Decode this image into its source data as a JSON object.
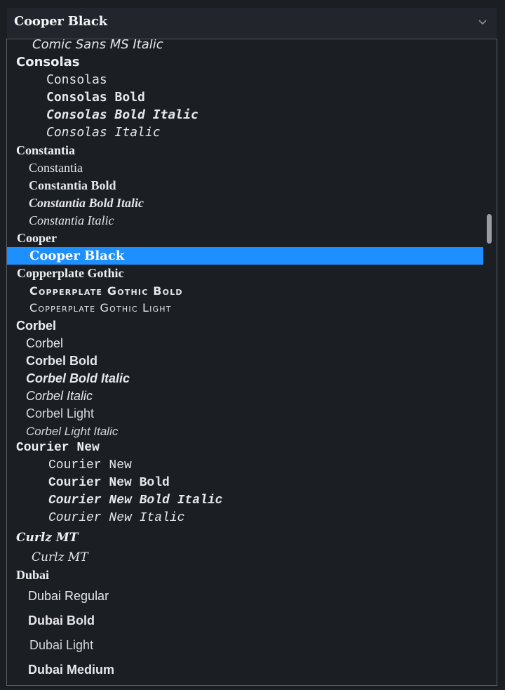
{
  "select": {
    "value": "Cooper Black",
    "icon": "chevron-down-icon"
  },
  "fonts": {
    "comic_sans_ms_italic": "Comic Sans MS Italic",
    "consolas": {
      "group": "Consolas",
      "items": [
        "Consolas",
        "Consolas Bold",
        "Consolas Bold Italic",
        "Consolas Italic"
      ]
    },
    "constantia": {
      "group": "Constantia",
      "items": [
        "Constantia",
        "Constantia Bold",
        "Constantia Bold Italic",
        "Constantia Italic"
      ]
    },
    "cooper": {
      "group": "Cooper",
      "items": [
        "Cooper Black"
      ]
    },
    "copperplate": {
      "group": "Copperplate Gothic",
      "items": [
        "Copperplate Gothic Bold",
        "Copperplate Gothic Light"
      ]
    },
    "corbel": {
      "group": "Corbel",
      "items": [
        "Corbel",
        "Corbel Bold",
        "Corbel Bold Italic",
        "Corbel Italic",
        "Corbel Light",
        "Corbel Light Italic"
      ]
    },
    "courier_new": {
      "group": "Courier New",
      "items": [
        "Courier New",
        "Courier New Bold",
        "Courier New Bold Italic",
        "Courier New Italic"
      ]
    },
    "curlz": {
      "group": "Curlz MT",
      "items": [
        "Curlz MT"
      ]
    },
    "dubai": {
      "group": "Dubai",
      "items": [
        "Dubai Regular",
        "Dubai Bold",
        "Dubai Light",
        "Dubai Medium"
      ]
    }
  },
  "selected_item": "Cooper Black",
  "colors": {
    "background": "#1b1e23",
    "selected": "#1e8fff",
    "border": "#5a5f66"
  }
}
